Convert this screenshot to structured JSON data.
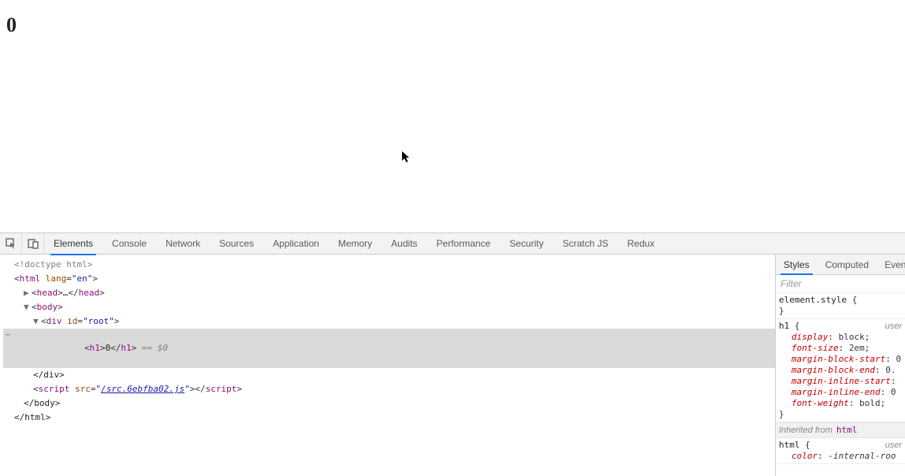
{
  "page": {
    "heading": "0"
  },
  "devtools": {
    "tabs": [
      "Elements",
      "Console",
      "Network",
      "Sources",
      "Application",
      "Memory",
      "Audits",
      "Performance",
      "Security",
      "Scratch JS",
      "Redux"
    ],
    "activeTab": "Elements",
    "elements": {
      "doctype": "<!doctype html>",
      "htmlOpen": {
        "tag": "html",
        "attr": "lang",
        "val": "en"
      },
      "headCollapsed": "…",
      "headTag": "head",
      "bodyTag": "body",
      "div": {
        "tag": "div",
        "attr": "id",
        "val": "root"
      },
      "h1": {
        "tag": "h1",
        "text": "0",
        "suffix": " == $0"
      },
      "script": {
        "tag": "script",
        "attr": "src",
        "val": "/src.6ebfba02.js"
      },
      "closeDiv": "</div>",
      "closeBody": "</body>",
      "closeHtml": "</html>"
    },
    "styles": {
      "tabs": [
        "Styles",
        "Computed",
        "Even"
      ],
      "activeTab": "Styles",
      "filterPlaceholder": "Filter",
      "elementStyleLabel": "element.style",
      "h1": {
        "selector": "h1",
        "origin": "user",
        "decls": [
          {
            "prop": "display",
            "val": "block"
          },
          {
            "prop": "font-size",
            "val": "2em"
          },
          {
            "prop": "margin-block-start",
            "val": "0."
          },
          {
            "prop": "margin-block-end",
            "val": "0."
          },
          {
            "prop": "margin-inline-start",
            "val": ""
          },
          {
            "prop": "margin-inline-end",
            "val": "0"
          },
          {
            "prop": "font-weight",
            "val": "bold"
          }
        ]
      },
      "inheritedLabel": "Inherited from",
      "inheritedFrom": "html",
      "html": {
        "selector": "html",
        "origin": "user",
        "decls": [
          {
            "prop": "color",
            "val": "-internal-roo"
          }
        ]
      }
    }
  }
}
